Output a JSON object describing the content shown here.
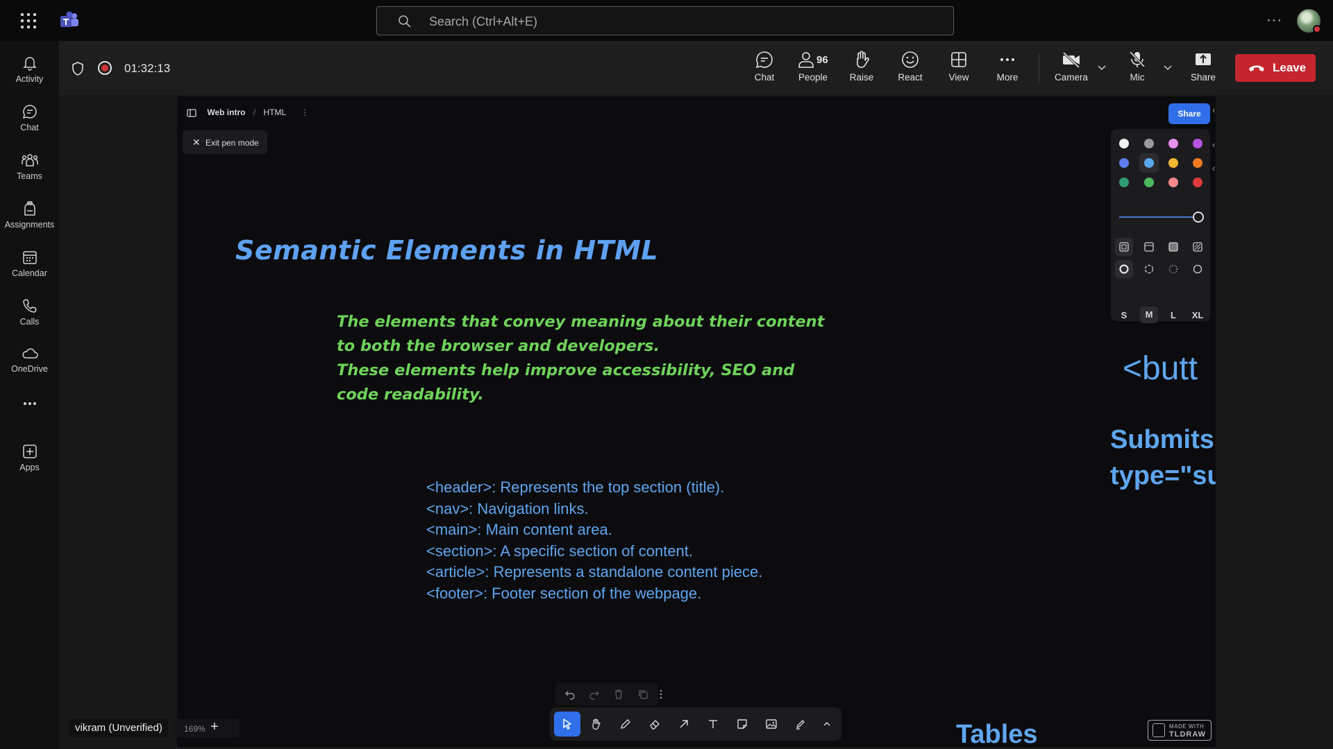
{
  "topbar": {
    "search_placeholder": "Search (Ctrl+Alt+E)",
    "more_label": "···"
  },
  "rail": {
    "items": [
      {
        "label": "Activity",
        "icon": "bell-icon"
      },
      {
        "label": "Chat",
        "icon": "chat-icon"
      },
      {
        "label": "Teams",
        "icon": "teams-icon"
      },
      {
        "label": "Assignments",
        "icon": "assignments-icon"
      },
      {
        "label": "Calendar",
        "icon": "calendar-icon"
      },
      {
        "label": "Calls",
        "icon": "phone-icon"
      },
      {
        "label": "OneDrive",
        "icon": "cloud-icon"
      },
      {
        "label": "",
        "icon": "more-icon"
      },
      {
        "label": "Apps",
        "icon": "add-app-icon"
      }
    ]
  },
  "meeting": {
    "timer": "01:32:13",
    "people_count": "96",
    "controls": {
      "chat": "Chat",
      "people": "People",
      "raise": "Raise",
      "react": "React",
      "view": "View",
      "more": "More",
      "camera": "Camera",
      "mic": "Mic",
      "share": "Share"
    },
    "leave_label": "Leave",
    "leave_color": "#c4262e"
  },
  "whiteboard": {
    "breadcrumb": {
      "first": "Web intro",
      "second": "HTML"
    },
    "exit_pen_label": "Exit pen mode",
    "share_label": "Share",
    "title": "Semantic Elements in HTML",
    "description_lines": [
      "The elements that convey meaning about their content",
      "to both the browser and developers.",
      "These elements help improve accessibility, SEO and",
      "code readability."
    ],
    "list_lines": [
      "<header>: Represents the top section (title).",
      "<nav>: Navigation links.",
      "<main>: Main content area.",
      "<section>: A specific section of content.",
      "<article>: Represents a standalone content piece.",
      "<footer>: Footer section of the webpage."
    ],
    "right_fragment_1": "<butt",
    "right_fragment_2a": "Submits",
    "right_fragment_2b": "type=\"su",
    "bottom_fragment": "Tables",
    "style_panel": {
      "colors": [
        "#f2f2f2",
        "#9a9a9f",
        "#e58ff0",
        "#b455e0",
        "#5c7cf0",
        "#5aa8ec",
        "#f2b830",
        "#f07b22",
        "#2f9e74",
        "#4cb85c",
        "#f28a8a",
        "#e03a3a"
      ],
      "selected_color": "#5aa8ec",
      "sizes": [
        "S",
        "M",
        "L",
        "XL"
      ],
      "selected_size": "M"
    },
    "made_with": {
      "line1": "MADE WITH",
      "line2": "TLDRAW"
    },
    "zoom_label": "169%",
    "zoom_add": "+"
  },
  "participant": {
    "name": "vikram (Unverified)"
  },
  "accent_color": "#2f6fea"
}
